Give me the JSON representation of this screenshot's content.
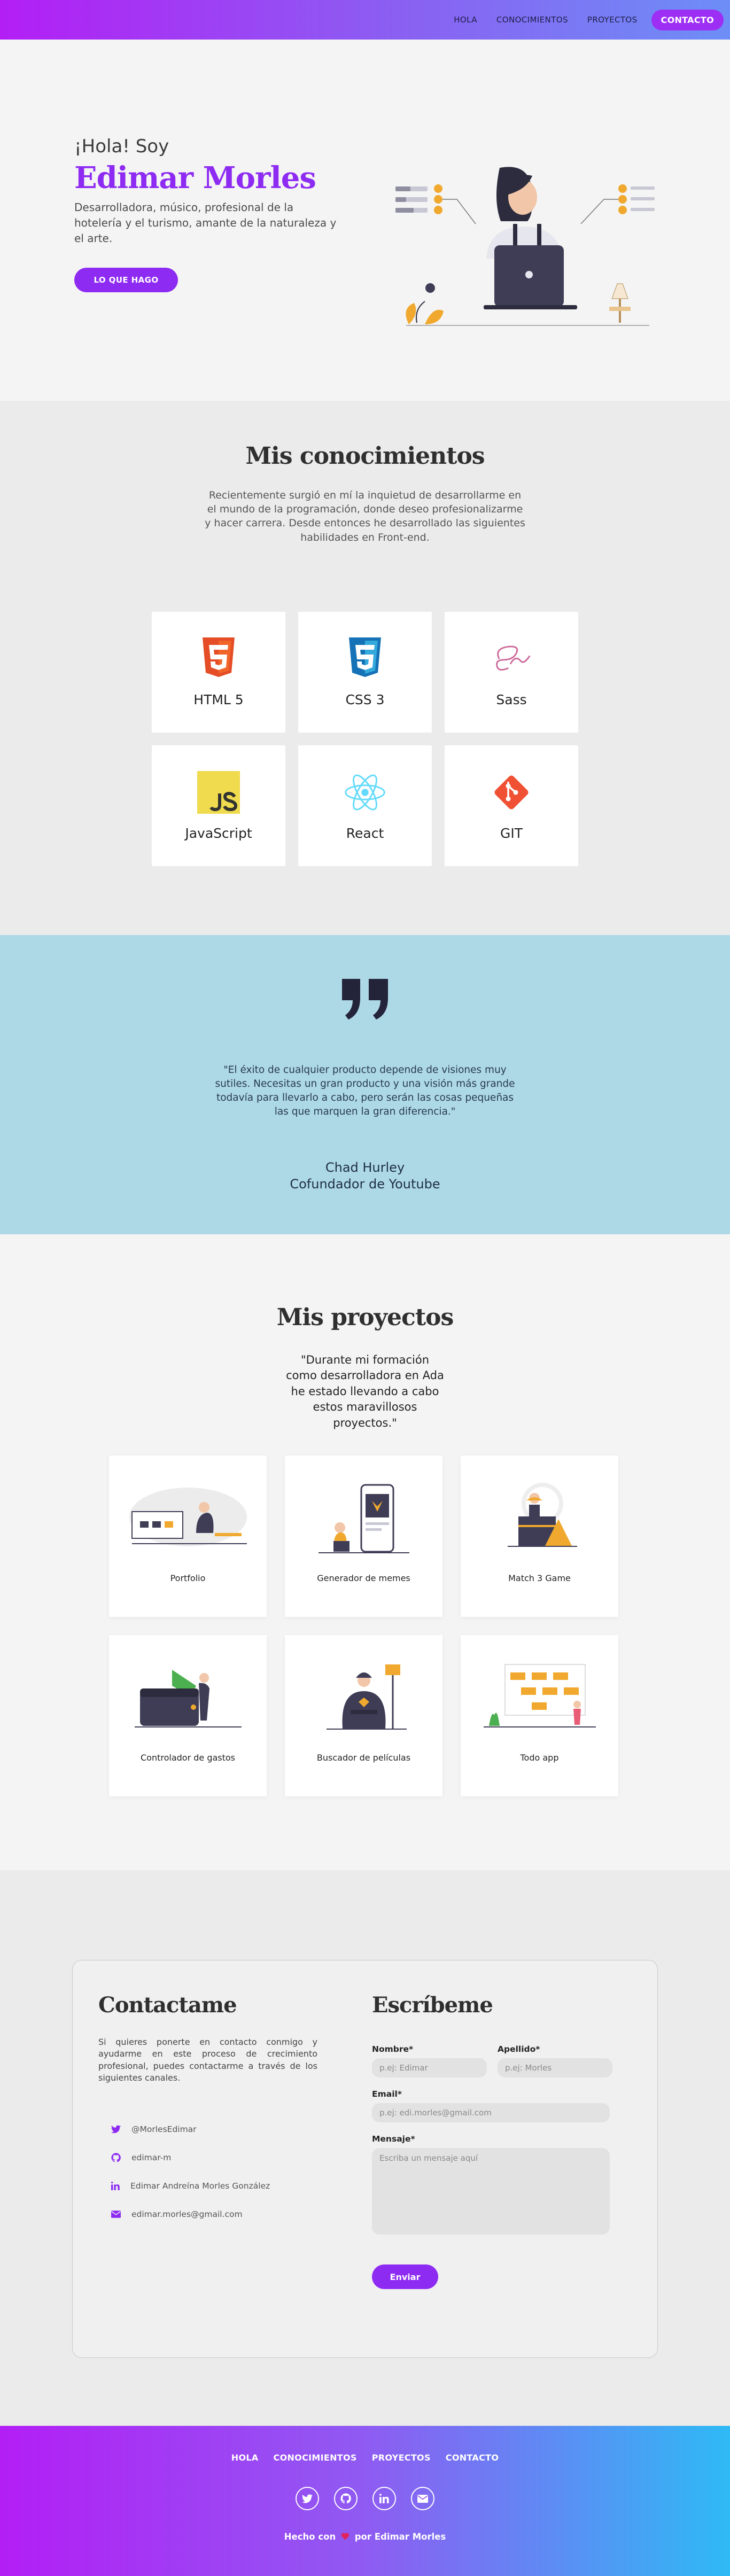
{
  "nav": {
    "items": [
      "HOLA",
      "CONOCIMIENTOS",
      "PROYECTOS"
    ],
    "cta": "CONTACTO"
  },
  "hero": {
    "greeting": "¡Hola! Soy",
    "name": "Edimar Morles",
    "description": "Desarrolladora, músico, profesional de la hotelería y el turismo, amante de la naturaleza y el arte.",
    "button": "LO QUE HAGO"
  },
  "skills": {
    "title": "Mis conocimientos",
    "description": "Recientemente surgió en mí la inquietud de desarrollarme en el mundo de la programación, donde deseo profesionalizarme y hacer carrera. Desde entonces he desarrollado las siguientes habilidades en Front-end.",
    "items": [
      {
        "label": "HTML 5",
        "icon": "html5-icon"
      },
      {
        "label": "CSS 3",
        "icon": "css3-icon"
      },
      {
        "label": "Sass",
        "icon": "sass-icon"
      },
      {
        "label": "JavaScript",
        "icon": "javascript-icon"
      },
      {
        "label": "React",
        "icon": "react-icon"
      },
      {
        "label": "GIT",
        "icon": "git-icon"
      }
    ]
  },
  "quote": {
    "text": "\"El éxito de cualquier producto depende de visiones muy sutiles. Necesitas un gran producto y una visión más grande todavía para llevarlo a cabo, pero serán las cosas pequeñas las que marquen la gran diferencia.\"",
    "author": "Chad Hurley",
    "role": "Cofundador de Youtube"
  },
  "projects": {
    "title": "Mis proyectos",
    "intro": "\"Durante mi formación como desarrolladora en Ada he estado llevando a cabo estos maravillosos proyectos.\"",
    "items": [
      "Portfolio",
      "Generador de memes",
      "Match 3 Game",
      "Controlador de gastos",
      "Buscador de películas",
      "Todo app"
    ]
  },
  "contact": {
    "title": "Contactame",
    "description": "Si quieres ponerte en contacto conmigo y ayudarme en este proceso de crecimiento profesional, puedes contactarme a través de los siguientes canales.",
    "links": [
      {
        "text": "@MorlesEdimar",
        "icon": "twitter-icon"
      },
      {
        "text": "edimar-m",
        "icon": "github-icon"
      },
      {
        "text": "Edimar Andreína Morles González",
        "icon": "linkedin-icon"
      },
      {
        "text": "edimar.morles@gmail.com",
        "icon": "email-icon"
      }
    ],
    "form": {
      "title": "Escríbeme",
      "name_label": "Nombre*",
      "name_placeholder": "p.ej: Edimar",
      "lastname_label": "Apellido*",
      "lastname_placeholder": "p.ej: Morles",
      "email_label": "Email*",
      "email_placeholder": "p.ej: edi.morles@gmail.com",
      "message_label": "Mensaje*",
      "message_placeholder": "Escriba un mensaje aquí",
      "submit": "Enviar"
    }
  },
  "footer": {
    "nav": [
      "HOLA",
      "CONOCIMIENTOS",
      "PROYECTOS",
      "CONTACTO"
    ],
    "made_prefix": "Hecho con",
    "made_suffix": "por Edimar Morles"
  },
  "colors": {
    "accent": "#8e2bf2",
    "quote_bg": "#add8e6"
  }
}
